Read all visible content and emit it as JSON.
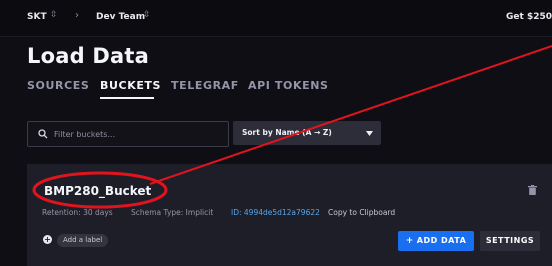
{
  "topbar": {
    "org": "SKT",
    "org_switcher": "⇳",
    "separator": "›",
    "team": "Dev Team",
    "team_switcher": "⇳",
    "promo": "Get $250"
  },
  "page": {
    "title": "Load Data"
  },
  "tabs": [
    {
      "label": "SOURCES",
      "active": false
    },
    {
      "label": "BUCKETS",
      "active": true
    },
    {
      "label": "TELEGRAF",
      "active": false
    },
    {
      "label": "API TOKENS",
      "active": false
    }
  ],
  "filter": {
    "placeholder": "Filter buckets..."
  },
  "sort": {
    "label": "Sort by Name (A → Z)"
  },
  "bucket": {
    "name": "BMP280_Bucket",
    "retention": "Retention: 30 days",
    "schema": "Schema Type: Implicit",
    "id": "ID: 4994de5d12a79622",
    "copy": "Copy to Clipboard",
    "add_label_icon": "+",
    "add_label": "Add a label",
    "add_data_icon": "+",
    "add_data": "ADD DATA",
    "settings": "SETTINGS"
  },
  "annotation": {
    "color": "#e0141e"
  }
}
